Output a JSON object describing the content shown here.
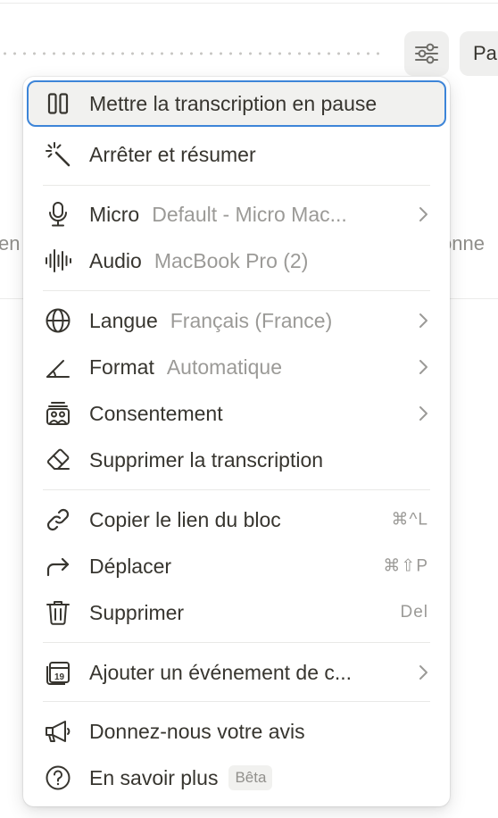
{
  "background": {
    "pause_button_label": "Pa",
    "left_fragment": "en",
    "right_fragment": "onne"
  },
  "menu": {
    "items": [
      {
        "label": "Mettre la transcription en pause",
        "icon": "pause-icon"
      },
      {
        "label": "Arrêter et résumer",
        "icon": "magic-wand-icon"
      },
      {
        "label": "Micro",
        "value": "Default - Micro Mac...",
        "icon": "microphone-icon"
      },
      {
        "label": "Audio",
        "value": "MacBook Pro (2)",
        "icon": "audio-wave-icon"
      },
      {
        "label": "Langue",
        "value": "Français (France)",
        "icon": "globe-icon"
      },
      {
        "label": "Format",
        "value": "Automatique",
        "icon": "format-icon"
      },
      {
        "label": "Consentement",
        "icon": "consent-icon"
      },
      {
        "label": "Supprimer la transcription",
        "icon": "eraser-icon"
      },
      {
        "label": "Copier le lien du bloc",
        "shortcut": "⌘^L",
        "icon": "link-icon"
      },
      {
        "label": "Déplacer",
        "shortcut": "⌘⇧P",
        "icon": "move-arrow-icon"
      },
      {
        "label": "Supprimer",
        "shortcut": "Del",
        "icon": "trash-icon"
      },
      {
        "label": "Ajouter un événement de c...",
        "icon": "calendar-icon",
        "calendar_day": "19"
      },
      {
        "label": "Donnez-nous votre avis",
        "icon": "megaphone-icon"
      },
      {
        "label": "En savoir plus",
        "badge": "Bêta",
        "icon": "help-circle-icon"
      }
    ]
  },
  "colors": {
    "focus_ring": "#3d85d8",
    "text": "#37352f",
    "muted": "#9b9a97",
    "hover_bg": "#f1f1ef"
  }
}
